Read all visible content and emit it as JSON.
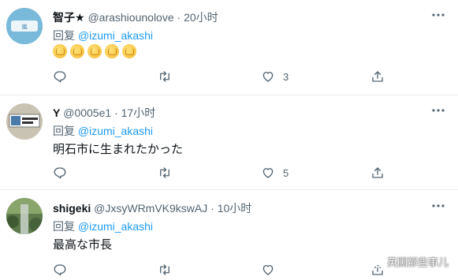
{
  "tweets": [
    {
      "name": "智子★",
      "handle": "@arashiounolove",
      "dot": "·",
      "time": "20小时",
      "reply_prefix": "回复",
      "reply_mention": "@izumi_akashi",
      "body_text": "",
      "body_emoji": [
        "clapping-hands",
        "clapping-hands",
        "clapping-hands",
        "clapping-hands",
        "clapping-hands"
      ],
      "likes": "3",
      "avatar_text": "THIS IS LOVE"
    },
    {
      "name": "Y",
      "handle": "@0005e1",
      "dot": "·",
      "time": "17小时",
      "reply_prefix": "回复",
      "reply_mention": "@izumi_akashi",
      "body_text": "明石市に生まれたかった",
      "likes": "5"
    },
    {
      "name": "shigeki",
      "handle": "@JxsyWRmVK9kswAJ",
      "dot": "·",
      "time": "10小时",
      "reply_prefix": "回复",
      "reply_mention": "@izumi_akashi",
      "body_text": "最高な市長",
      "likes": ""
    }
  ],
  "watermark": "英国那些事儿",
  "colors": {
    "accent": "#1d9bf0",
    "muted": "#536471",
    "divider": "#e6ecf0"
  },
  "icons": [
    "more-icon",
    "reply-icon",
    "retweet-icon",
    "like-icon",
    "share-icon",
    "wechat-icon"
  ]
}
